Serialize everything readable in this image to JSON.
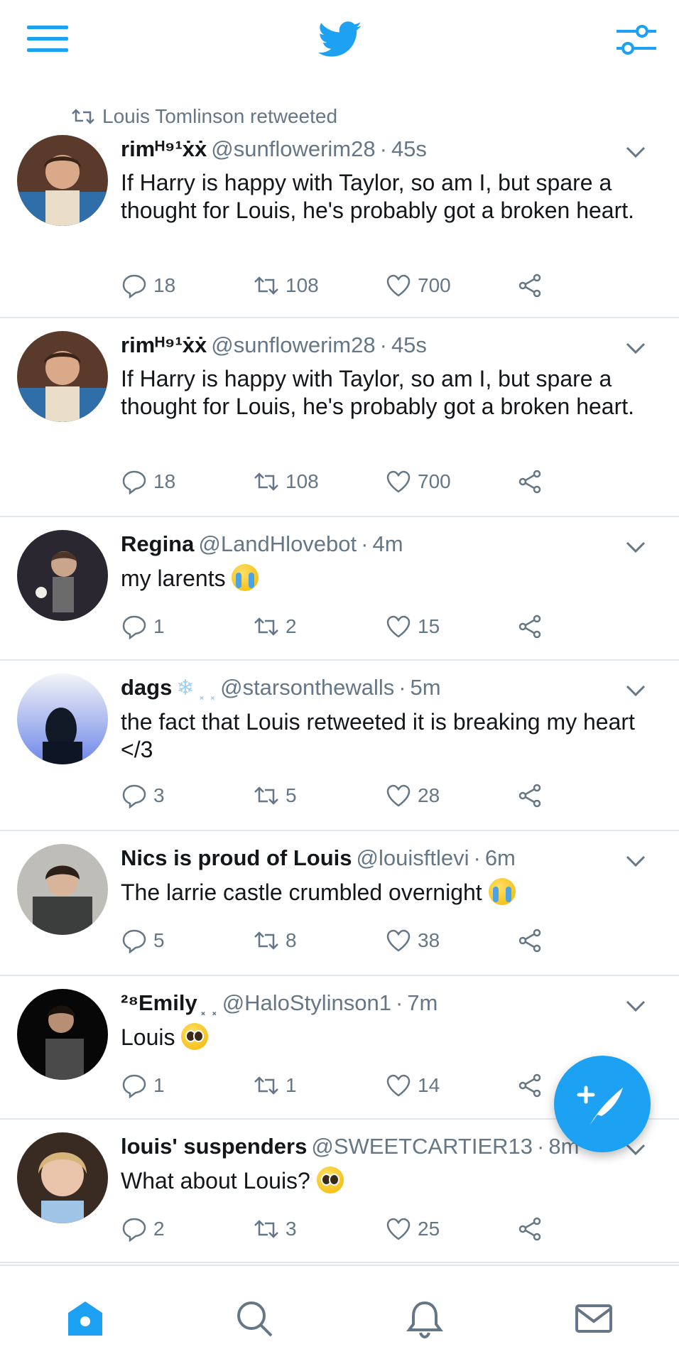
{
  "colors": {
    "accent": "#1da1f2",
    "muted": "#657786",
    "text": "#14171a",
    "divider": "#e1e8ed"
  },
  "icons": {
    "menu": "hamburger-menu-icon",
    "logo": "twitter-bird-logo",
    "filter": "sliders-icon",
    "reply": "reply-icon",
    "retweet": "retweet-icon",
    "like": "heart-icon",
    "share": "share-icon",
    "compose": "compose-tweet-icon"
  },
  "retweet_banner": "Louis Tomlinson retweeted",
  "tweets": [
    {
      "name": "rimᴴ⁹¹ẋẋ",
      "handle": "@sunflowerim28",
      "dot": "·",
      "time": "45s",
      "text": "If Harry is happy with Taylor, so am I, but spare a thought for Louis, he's probably got a broken heart.",
      "replies": "18",
      "retweets": "108",
      "likes": "700"
    },
    {
      "name": "rimᴴ⁹¹ẋẋ",
      "handle": "@sunflowerim28",
      "dot": "·",
      "time": "45s",
      "text": "If Harry is happy with Taylor, so am I, but spare a thought for Louis, he's probably got a broken heart.",
      "replies": "18",
      "retweets": "108",
      "likes": "700"
    },
    {
      "name": "Regina",
      "handle": "@LandHlovebot",
      "dot": "·",
      "time": "4m",
      "text": "my larents",
      "replies": "1",
      "retweets": "2",
      "likes": "15"
    },
    {
      "name": "dags",
      "name_suffix": "❄ ⸼ ⸼",
      "handle": "@starsonthewalls",
      "dot": "·",
      "time": "5m",
      "text": "the fact that Louis retweeted it is breaking my heart </3",
      "replies": "3",
      "retweets": "5",
      "likes": "28"
    },
    {
      "name": "Nics is proud of Louis",
      "handle": "@louisftlevi",
      "dot": "·",
      "time": "6m",
      "text": "The larrie castle crumbled overnight",
      "replies": "5",
      "retweets": "8",
      "likes": "38"
    },
    {
      "name": "²⁸Emily",
      "name_suffix": "⸼ ⸼",
      "handle": "@HaloStylinson1",
      "dot": "·",
      "time": "7m",
      "text": "Louis",
      "replies": "1",
      "retweets": "1",
      "likes": "14"
    },
    {
      "name": "louis' suspenders",
      "handle": "@SWEETCARTIER13",
      "dot": "·",
      "time": "8m",
      "text": "What about Louis?",
      "replies": "2",
      "retweets": "3",
      "likes": "25"
    }
  ],
  "bottom_nav": [
    "home-icon",
    "search-icon",
    "notifications-icon",
    "messages-icon"
  ]
}
